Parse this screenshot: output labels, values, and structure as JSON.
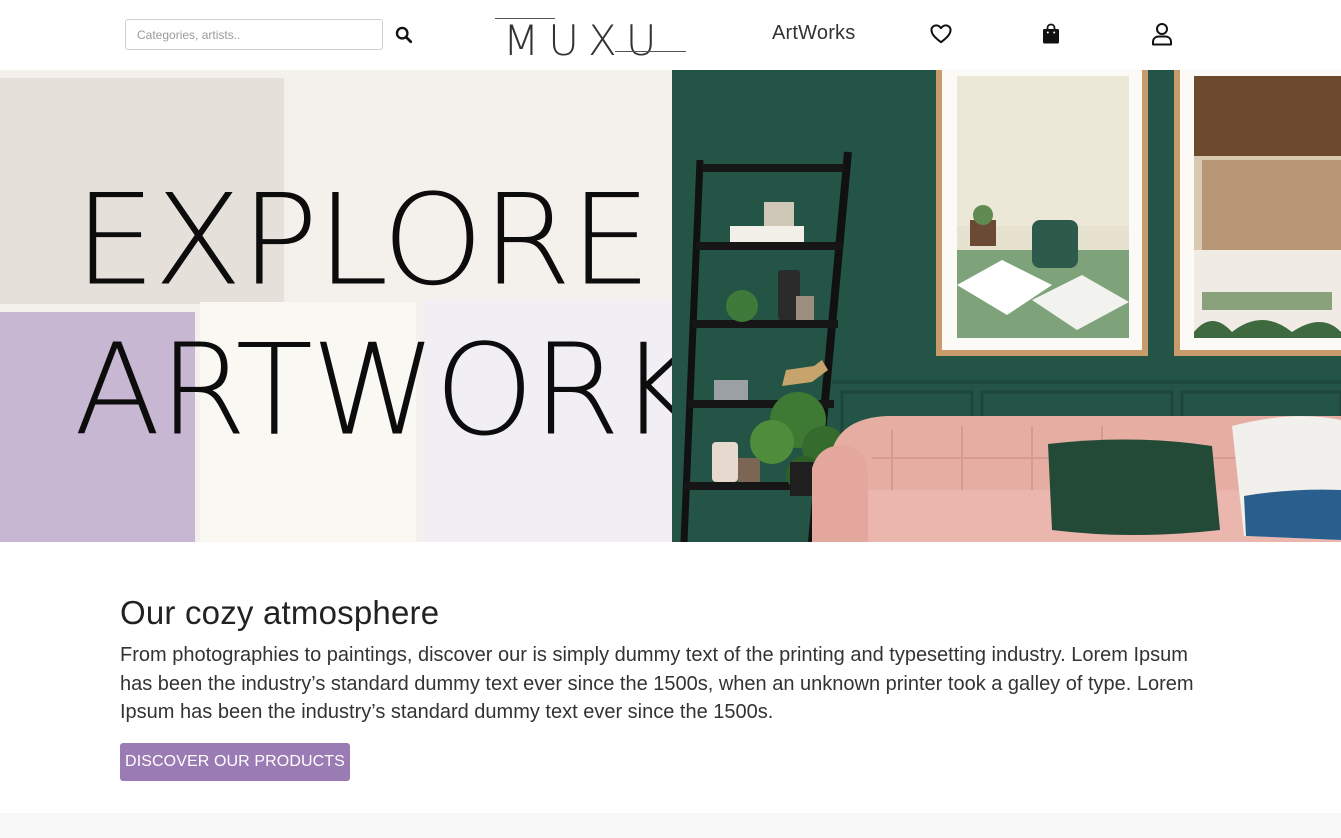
{
  "header": {
    "search": {
      "placeholder": "Categories, artists..",
      "value": "",
      "icon": "search-icon"
    },
    "logo": {
      "text": "MUXU"
    },
    "nav": {
      "artworks_label": "ArtWorks"
    },
    "icons": {
      "wishlist": "heart-icon",
      "cart": "shopping-bag-icon",
      "account": "user-icon"
    }
  },
  "hero": {
    "title_line1": "EXPLORE",
    "title_line2": "ARTWORK .",
    "colors": {
      "panel_beige": "#e6e0da",
      "panel_lilac": "#c7b7d3",
      "panel_cream": "#f9f8f3",
      "panel_pale_lilac": "#f1eff4",
      "wall_green": "#245446",
      "sofa_pink": "#e6ada3"
    }
  },
  "section": {
    "title": "Our cozy atmosphere",
    "body": "From photographies to paintings, discover our is simply dummy text of the printing and typesetting industry. Lorem Ipsum has been the industry’s standard dummy text ever since the 1500s, when an unknown printer took a galley of type. Lorem Ipsum has been the industry’s standard dummy text ever since the 1500s.",
    "cta_label": "DISCOVER OUR PRODUCTS"
  },
  "theme": {
    "accent": "#9b7bb4"
  }
}
